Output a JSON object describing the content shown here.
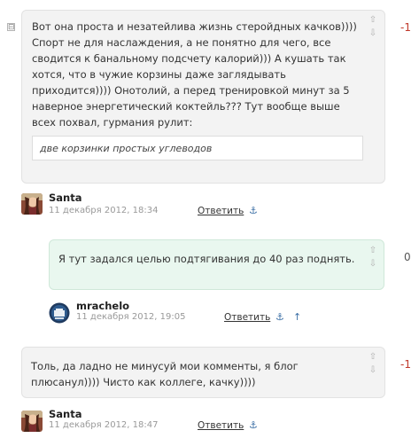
{
  "comments": [
    {
      "text": "Вот она проста и незатейлива жизнь стеройдных качков)))) Спорт не для наслаждения, а не понятно для чего, все сводится к банальному подсчету калорий))) А кушать так хотся, что в чужие корзины даже заглядывать приходится)))) Онотолий, а перед тренировкой минут за 5 наверное энергетический коктейль??? Тут вообще выше всех похвал, гурмания рулит:",
      "quote": "две корзинки простых углеводов",
      "score": "-1",
      "author": "Santa",
      "date": "11 декабря 2012, 18:34",
      "reply": "Ответить",
      "collapse": "⊟"
    },
    {
      "text": "Я тут задался целью подтягивания до 40 раз поднять.",
      "score": "0",
      "author": "mrachelo",
      "date": "11 декабря 2012, 19:05",
      "reply": "Ответить"
    },
    {
      "text": "Толь, да ладно не минусуй мои комменты, я блог плюсанул)))) Чисто как коллеге, качку))))",
      "score": "-1",
      "author": "Santa",
      "date": "11 декабря 2012, 18:47",
      "reply": "Ответить"
    }
  ],
  "icons": {
    "vote_up": "⇧",
    "vote_down": "⇩",
    "anchor": "⚓",
    "parent": "↑"
  },
  "colors": {
    "negative": "#c0392b",
    "link": "#3a6ea5",
    "reply_bg": "#e9f7ef"
  }
}
